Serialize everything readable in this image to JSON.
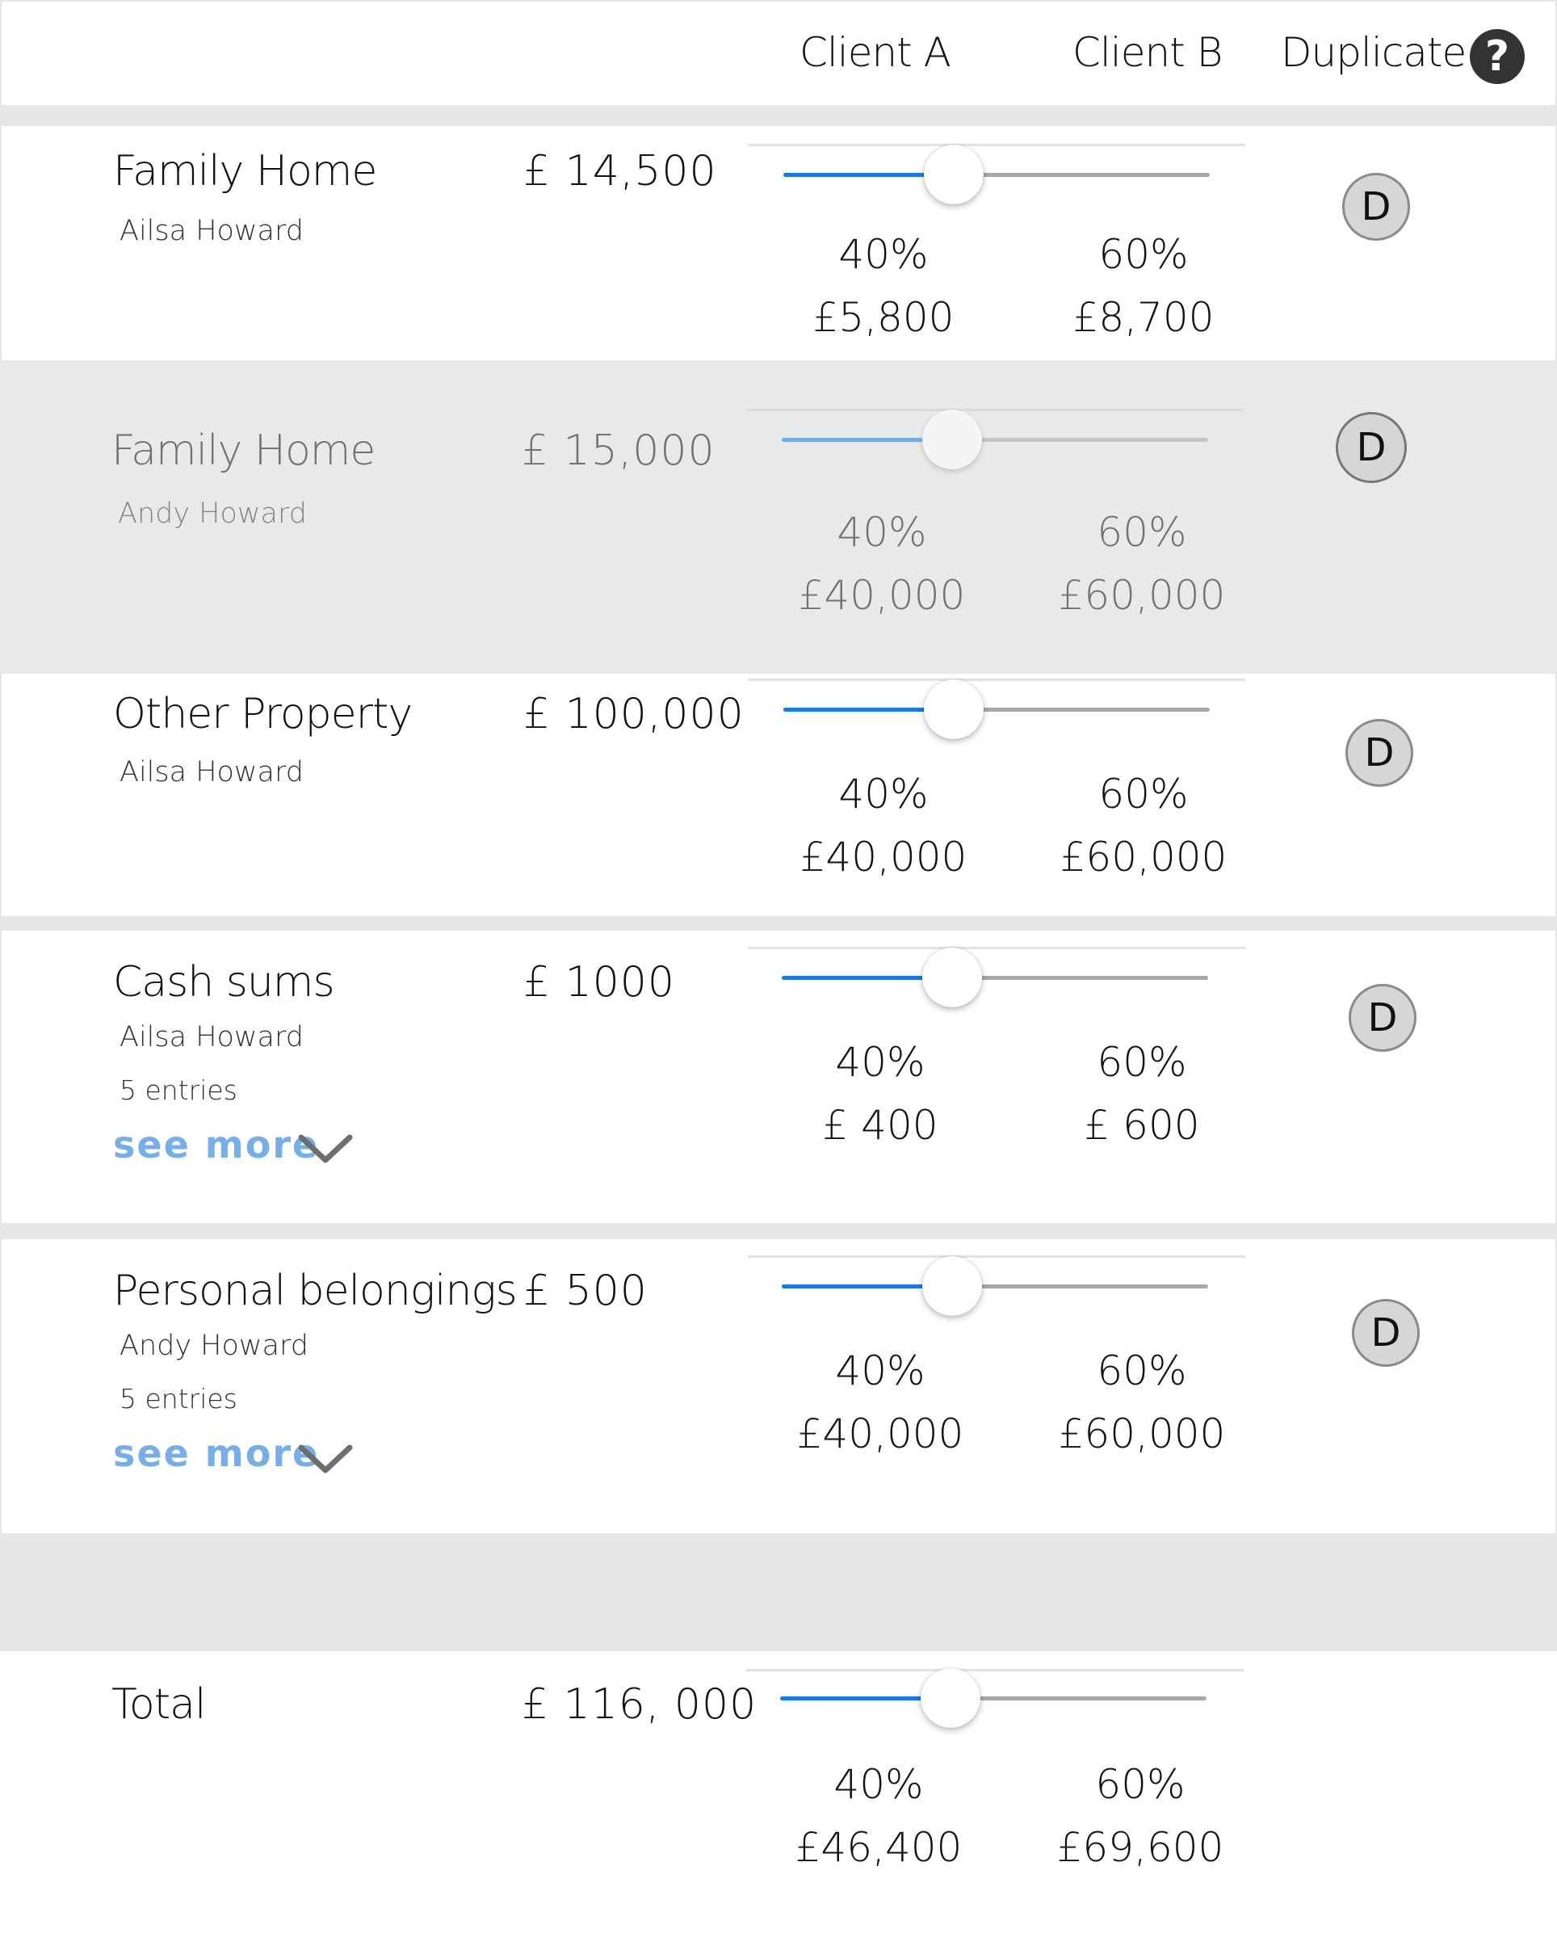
{
  "header": {
    "client_a": "Client A",
    "client_b": "Client B",
    "duplicate": "Duplicate",
    "help_glyph": "?"
  },
  "rows": [
    {
      "name": "Family Home",
      "owner": "Ailsa Howard",
      "amount": "£ 14,500",
      "split_a": 0.4,
      "pct_a": "40%",
      "pct_b": "60%",
      "val_a": "£5,800",
      "val_b": "£8,700",
      "dup_label": "D"
    },
    {
      "name": "Family Home",
      "owner": "Andy Howard",
      "amount": "£ 15,000",
      "split_a": 0.4,
      "pct_a": "40%",
      "pct_b": "60%",
      "val_a": "£40,000",
      "val_b": "£60,000",
      "dup_label": "D"
    },
    {
      "name": "Other Property",
      "owner": "Ailsa Howard",
      "amount": "£ 100,000",
      "split_a": 0.4,
      "pct_a": "40%",
      "pct_b": "60%",
      "val_a": "£40,000",
      "val_b": "£60,000",
      "dup_label": "D"
    },
    {
      "name": "Cash sums",
      "owner": "Ailsa Howard",
      "entries": "5 entries",
      "see_more": "see more",
      "amount": "£ 1000",
      "split_a": 0.4,
      "pct_a": "40%",
      "pct_b": "60%",
      "val_a": "£ 400",
      "val_b": "£ 600",
      "dup_label": "D"
    },
    {
      "name": "Personal belongings",
      "owner": "Andy Howard",
      "entries": "5 entries",
      "see_more": "see more",
      "amount": "£ 500",
      "split_a": 0.4,
      "pct_a": "40%",
      "pct_b": "60%",
      "val_a": "£40,000",
      "val_b": "£60,000",
      "dup_label": "D"
    }
  ],
  "total": {
    "name": "Total",
    "amount": "£ 116, 000",
    "split_a": 0.4,
    "pct_a": "40%",
    "pct_b": "60%",
    "val_a": "£46,400",
    "val_b": "£69,600"
  },
  "colors": {
    "slider_fill": "#1a7ae0",
    "slider_rest": "#a8a8a8",
    "link": "#76aee8",
    "band": "#e6e6e6"
  },
  "icons": {
    "help": "question-circle-icon",
    "see_more": "chevron-down-icon"
  }
}
